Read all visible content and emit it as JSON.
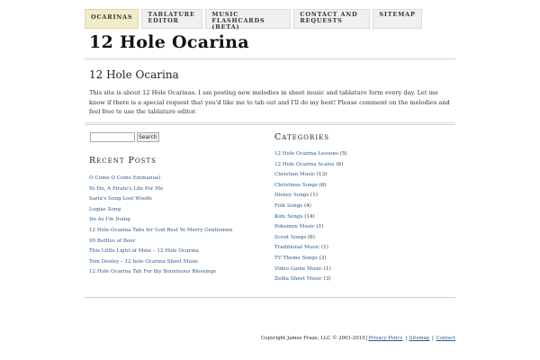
{
  "nav": {
    "items": [
      {
        "label": "Ocarinas",
        "active": true
      },
      {
        "label": "Tablature Editor",
        "active": false
      },
      {
        "label": "Music Flashcards (Beta)",
        "active": false
      },
      {
        "label": "Contact and Requests",
        "active": false
      },
      {
        "label": "Sitemap",
        "active": false
      }
    ]
  },
  "site": {
    "title": "12 Hole Ocarina"
  },
  "page": {
    "title": "12 Hole Ocarina",
    "intro": "This site is about 12 Hole Ocarinas. I am posting new melodies in sheet music and tablature form every day. Let me know if there is a special request that you'd like me to tab out and I'll do my best! Please comment on the melodies and feel free to use the tablature editor."
  },
  "search": {
    "button_label": "Search",
    "value": ""
  },
  "recent_posts": {
    "title": "Recent Posts",
    "items": [
      "O Come O Come Emmanuel",
      "Yo Ho, A Pirate's Life For Me",
      "Saria's Song Lost Woods",
      "Lugias Song",
      "Do As I'm Doing",
      "12 Hole Ocarina Tabs for God Rest Ye Merry Gentlemen",
      "99 Bottles of Beer",
      "This Little Light of Mine – 12 Hole Ocarina",
      "Tom Dooley – 12 hole Ocarina Sheet Music",
      "12 Hole Ocarina Tab For thy Bounteous Blessings"
    ]
  },
  "categories": {
    "title": "Categories",
    "items": [
      {
        "name": "12 Hole Ocarina Lessons",
        "count": "(5)"
      },
      {
        "name": "12 Hole Ocarina Scales",
        "count": "(6)"
      },
      {
        "name": "Christian Music",
        "count": "(13)"
      },
      {
        "name": "Christmas Songs",
        "count": "(6)"
      },
      {
        "name": "Disney Songs",
        "count": "(1)"
      },
      {
        "name": "Folk Songs",
        "count": "(4)"
      },
      {
        "name": "Kids Songs",
        "count": "(14)"
      },
      {
        "name": "Pokemon Music",
        "count": "(1)"
      },
      {
        "name": "Scout Songs",
        "count": "(6)"
      },
      {
        "name": "Traditional Music",
        "count": "(1)"
      },
      {
        "name": "TV Theme Songs",
        "count": "(3)"
      },
      {
        "name": "Video Game Music",
        "count": "(1)"
      },
      {
        "name": "Zelda Sheet Music",
        "count": "(3)"
      }
    ]
  },
  "footer": {
    "copyright": "Copyright James Fraze, LLC © 2001-2015",
    "sep1": "|",
    "privacy": "Privacy Policy",
    "sep2": "|",
    "sitemap": "Sitemap",
    "sep3": "|",
    "contact": "Contact"
  },
  "colors": {
    "link": "#2a5a8c",
    "active_tab": "#f1ecc9",
    "tab": "#f0f0f0"
  }
}
